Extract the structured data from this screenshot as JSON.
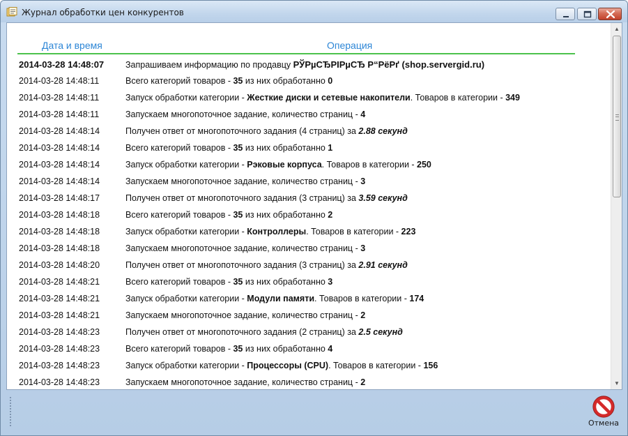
{
  "window": {
    "title": "Журнал обработки цен конкурентов",
    "cancel_label": "Отмена"
  },
  "log": {
    "headers": {
      "date": "Дата и время",
      "operation": "Операция"
    },
    "rows": [
      {
        "dt": "2014-03-28 14:48:07",
        "parts": [
          {
            "t": "Запрашиваем информацию по продавцу "
          },
          {
            "t": "РЎРµСЂРІРµСЂ Р“РёРґ (shop.servergid.ru)",
            "s": "b"
          }
        ]
      },
      {
        "dt": "2014-03-28 14:48:11",
        "parts": [
          {
            "t": "Всего категорий товаров - "
          },
          {
            "t": "35",
            "s": "b"
          },
          {
            "t": " из них обработанно "
          },
          {
            "t": "0",
            "s": "b"
          }
        ]
      },
      {
        "dt": "2014-03-28 14:48:11",
        "parts": [
          {
            "t": "Запуск обработки категории - "
          },
          {
            "t": "Жесткие диски и сетевые накопители",
            "s": "b"
          },
          {
            "t": ". Товаров в категории - "
          },
          {
            "t": "349",
            "s": "b"
          }
        ]
      },
      {
        "dt": "2014-03-28 14:48:11",
        "parts": [
          {
            "t": "Запускаем многопоточное задание, количество страниц - "
          },
          {
            "t": "4",
            "s": "b"
          }
        ]
      },
      {
        "dt": "2014-03-28 14:48:14",
        "parts": [
          {
            "t": "Получен ответ от многопоточного задания (4 страниц) за "
          },
          {
            "t": "2.88 секунд",
            "s": "bi"
          }
        ]
      },
      {
        "dt": "2014-03-28 14:48:14",
        "parts": [
          {
            "t": "Всего категорий товаров - "
          },
          {
            "t": "35",
            "s": "b"
          },
          {
            "t": " из них обработанно "
          },
          {
            "t": "1",
            "s": "b"
          }
        ]
      },
      {
        "dt": "2014-03-28 14:48:14",
        "parts": [
          {
            "t": "Запуск обработки категории - "
          },
          {
            "t": "Рэковые корпуса",
            "s": "b"
          },
          {
            "t": ". Товаров в категории - "
          },
          {
            "t": "250",
            "s": "b"
          }
        ]
      },
      {
        "dt": "2014-03-28 14:48:14",
        "parts": [
          {
            "t": "Запускаем многопоточное задание, количество страниц - "
          },
          {
            "t": "3",
            "s": "b"
          }
        ]
      },
      {
        "dt": "2014-03-28 14:48:17",
        "parts": [
          {
            "t": "Получен ответ от многопоточного задания (3 страниц) за "
          },
          {
            "t": "3.59 секунд",
            "s": "bi"
          }
        ]
      },
      {
        "dt": "2014-03-28 14:48:18",
        "parts": [
          {
            "t": "Всего категорий товаров - "
          },
          {
            "t": "35",
            "s": "b"
          },
          {
            "t": " из них обработанно "
          },
          {
            "t": "2",
            "s": "b"
          }
        ]
      },
      {
        "dt": "2014-03-28 14:48:18",
        "parts": [
          {
            "t": "Запуск обработки категории - "
          },
          {
            "t": "Контроллеры",
            "s": "b"
          },
          {
            "t": ". Товаров в категории - "
          },
          {
            "t": "223",
            "s": "b"
          }
        ]
      },
      {
        "dt": "2014-03-28 14:48:18",
        "parts": [
          {
            "t": "Запускаем многопоточное задание, количество страниц - "
          },
          {
            "t": "3",
            "s": "b"
          }
        ]
      },
      {
        "dt": "2014-03-28 14:48:20",
        "parts": [
          {
            "t": "Получен ответ от многопоточного задания (3 страниц) за "
          },
          {
            "t": "2.91 секунд",
            "s": "bi"
          }
        ]
      },
      {
        "dt": "2014-03-28 14:48:21",
        "parts": [
          {
            "t": "Всего категорий товаров - "
          },
          {
            "t": "35",
            "s": "b"
          },
          {
            "t": " из них обработанно "
          },
          {
            "t": "3",
            "s": "b"
          }
        ]
      },
      {
        "dt": "2014-03-28 14:48:21",
        "parts": [
          {
            "t": "Запуск обработки категории - "
          },
          {
            "t": "Модули памяти",
            "s": "b"
          },
          {
            "t": ". Товаров в категории - "
          },
          {
            "t": "174",
            "s": "b"
          }
        ]
      },
      {
        "dt": "2014-03-28 14:48:21",
        "parts": [
          {
            "t": "Запускаем многопоточное задание, количество страниц - "
          },
          {
            "t": "2",
            "s": "b"
          }
        ]
      },
      {
        "dt": "2014-03-28 14:48:23",
        "parts": [
          {
            "t": "Получен ответ от многопоточного задания (2 страниц) за "
          },
          {
            "t": "2.5 секунд",
            "s": "bi"
          }
        ]
      },
      {
        "dt": "2014-03-28 14:48:23",
        "parts": [
          {
            "t": "Всего категорий товаров - "
          },
          {
            "t": "35",
            "s": "b"
          },
          {
            "t": " из них обработанно "
          },
          {
            "t": "4",
            "s": "b"
          }
        ]
      },
      {
        "dt": "2014-03-28 14:48:23",
        "parts": [
          {
            "t": "Запуск обработки категории - "
          },
          {
            "t": "Процессоры (CPU)",
            "s": "b"
          },
          {
            "t": ". Товаров в категории - "
          },
          {
            "t": "156",
            "s": "b"
          }
        ]
      },
      {
        "dt": "2014-03-28 14:48:23",
        "parts": [
          {
            "t": "Запускаем многопоточное задание, количество страниц - "
          },
          {
            "t": "2",
            "s": "b"
          }
        ]
      }
    ]
  },
  "icons": {
    "app": "log-document-icon",
    "minimize": "minimize-icon",
    "maximize": "maximize-icon",
    "close": "close-icon",
    "cancel": "cancel-stop-icon",
    "scroll_up": "scroll-up-arrow-icon",
    "scroll_down": "scroll-down-arrow-icon"
  },
  "colors": {
    "header_text": "#2d86d6",
    "header_rule": "#4cc24c",
    "cancel_red": "#d42a2a"
  }
}
